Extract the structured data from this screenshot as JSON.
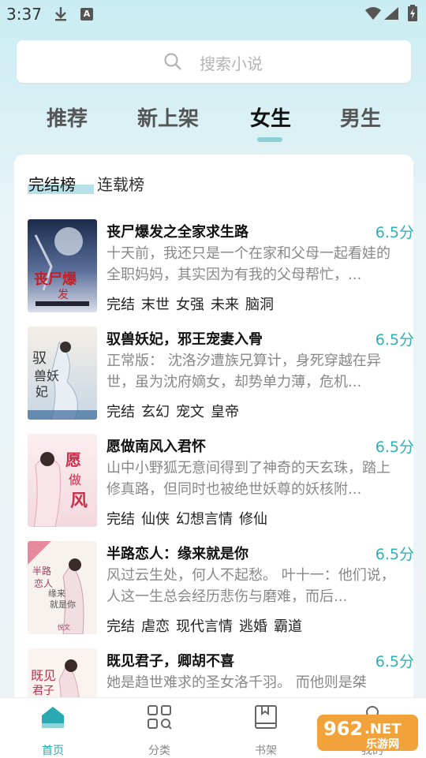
{
  "status": {
    "time": "3:37"
  },
  "search": {
    "placeholder": "搜索小说"
  },
  "tabs": [
    {
      "label": "推荐",
      "active": false
    },
    {
      "label": "新上架",
      "active": false
    },
    {
      "label": "女生",
      "active": true
    },
    {
      "label": "男生",
      "active": false
    }
  ],
  "subtabs": [
    {
      "label": "完结榜",
      "active": true
    },
    {
      "label": "连载榜",
      "active": false
    }
  ],
  "books": [
    {
      "title": "丧尸爆发之全家求生路",
      "score": "6.5分",
      "desc": "十天前，我还只是一个在家和父母一起看娃的全职妈妈，其实因为有我的父母帮忙，...",
      "tags": [
        "完结",
        "末世",
        "女强",
        "未来",
        "脑洞"
      ]
    },
    {
      "title": "驭兽妖妃，邪王宠妻入骨",
      "score": "6.5分",
      "desc": "正常版： 沈洛汐遭族兄算计，身死穿越在异世，虽为沈府嫡女，却势单力薄，危机...",
      "tags": [
        "完结",
        "玄幻",
        "宠文",
        "皇帝"
      ]
    },
    {
      "title": "愿做南风入君怀",
      "score": "6.5分",
      "desc": "山中小野狐无意间得到了神奇的天玄珠，踏上修真路，但同时也被绝世妖尊的妖核附...",
      "tags": [
        "完结",
        "仙侠",
        "幻想言情",
        "修仙"
      ]
    },
    {
      "title": "半路恋人：缘来就是你",
      "score": "6.5分",
      "desc": "风过云生处，何人不起愁。 叶十一：他们说，人这一生总会经历悲伤与磨难，而后...",
      "tags": [
        "完结",
        "虐恋",
        "现代言情",
        "逃婚",
        "霸道"
      ]
    },
    {
      "title": "既见君子，卿胡不喜",
      "score": "6.5分",
      "desc": "她是趋世难求的圣女洛千羽。 而他则是桀",
      "tags": []
    }
  ],
  "bottom_nav": [
    {
      "label": "首页",
      "icon": "home-icon",
      "active": true
    },
    {
      "label": "分类",
      "icon": "category-icon",
      "active": false
    },
    {
      "label": "书架",
      "icon": "bookshelf-icon",
      "active": false
    },
    {
      "label": "我的",
      "icon": "profile-icon",
      "active": false
    }
  ],
  "watermark": {
    "number": "962",
    "suffix": ".NET",
    "text": "乐游网"
  },
  "colors": {
    "accent": "#27a9b2",
    "score": "#2db0b8",
    "indicator": "#8ecfd6"
  }
}
